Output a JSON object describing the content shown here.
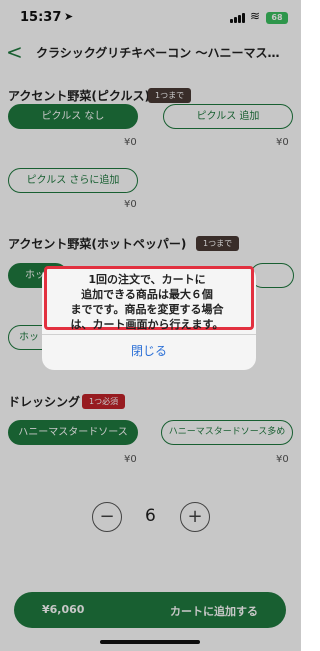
{
  "status": {
    "time": "15:37",
    "battery": "68"
  },
  "nav": {
    "title": "クラシックグリチキベーコン ～ハニーマス…"
  },
  "sections": [
    {
      "title": "アクセント野菜(ピクルス)",
      "badge": "1つまで",
      "options": [
        {
          "label": "ピクルス なし",
          "price": "¥0",
          "selected": true
        },
        {
          "label": "ピクルス 追加",
          "price": "¥0",
          "selected": false
        },
        {
          "label": "ピクルス さらに追加",
          "price": "¥0",
          "selected": false
        }
      ]
    },
    {
      "title": "アクセント野菜(ホットペッパー)",
      "badge": "1つまで",
      "options": [
        {
          "label": "ホッ",
          "price": "",
          "selected": true
        },
        {
          "label": "",
          "price": "",
          "selected": false
        },
        {
          "label": "ホット",
          "price": "",
          "selected": false
        }
      ]
    },
    {
      "title": "ドレッシング",
      "badge": "1つ必須",
      "options": [
        {
          "label": "ハニーマスタードソース",
          "price": "¥0",
          "selected": true
        },
        {
          "label": "ハニーマスタードソース多め",
          "price": "¥0",
          "selected": false
        }
      ]
    }
  ],
  "quantity": {
    "minus": "−",
    "value": "6",
    "plus": "+"
  },
  "cart": {
    "total": "¥6,060",
    "add_label": "カートに追加する"
  },
  "dialog": {
    "message_lines": [
      "1回の注文で、カートに",
      "追加できる商品は最大６個",
      "までです。商品を変更する場合",
      "は、カート画面から行えます。"
    ],
    "close_label": "閉じる"
  },
  "colors": {
    "accent": "#1f7a3f",
    "badge_dark": "#4a3a35",
    "badge_red": "#c2232a",
    "highlight": "#e2303f",
    "link": "#2a6fd6"
  }
}
